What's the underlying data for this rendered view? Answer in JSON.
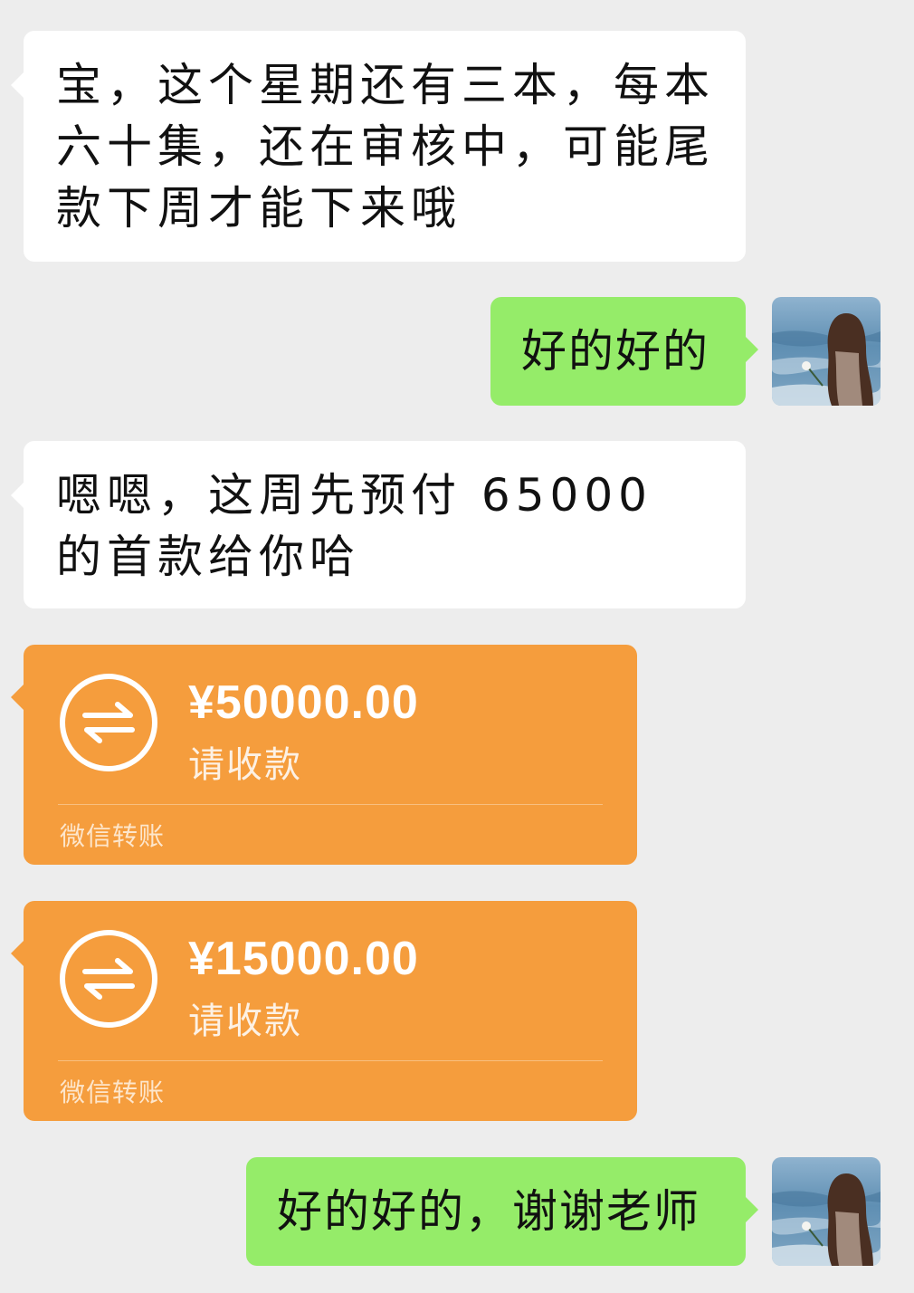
{
  "messages": {
    "msg1": "宝，这个星期还有三本，每本六十集，还在审核中，可能尾款下周才能下来哦",
    "msg2": "好的好的",
    "msg3": "嗯嗯，这周先预付 65000 的首款给你哈",
    "msg6": "好的好的，谢谢老师"
  },
  "transfers": [
    {
      "amount": "¥50000.00",
      "status": "请收款",
      "footer": "微信转账"
    },
    {
      "amount": "¥15000.00",
      "status": "请收款",
      "footer": "微信转账"
    }
  ],
  "icons": {
    "transfer": "transfer-arrows-icon",
    "avatar": "user-avatar-photo"
  },
  "colors": {
    "background": "#ededed",
    "incoming_bubble": "#ffffff",
    "outgoing_bubble": "#95ec69",
    "transfer_card": "#f59d3d"
  }
}
